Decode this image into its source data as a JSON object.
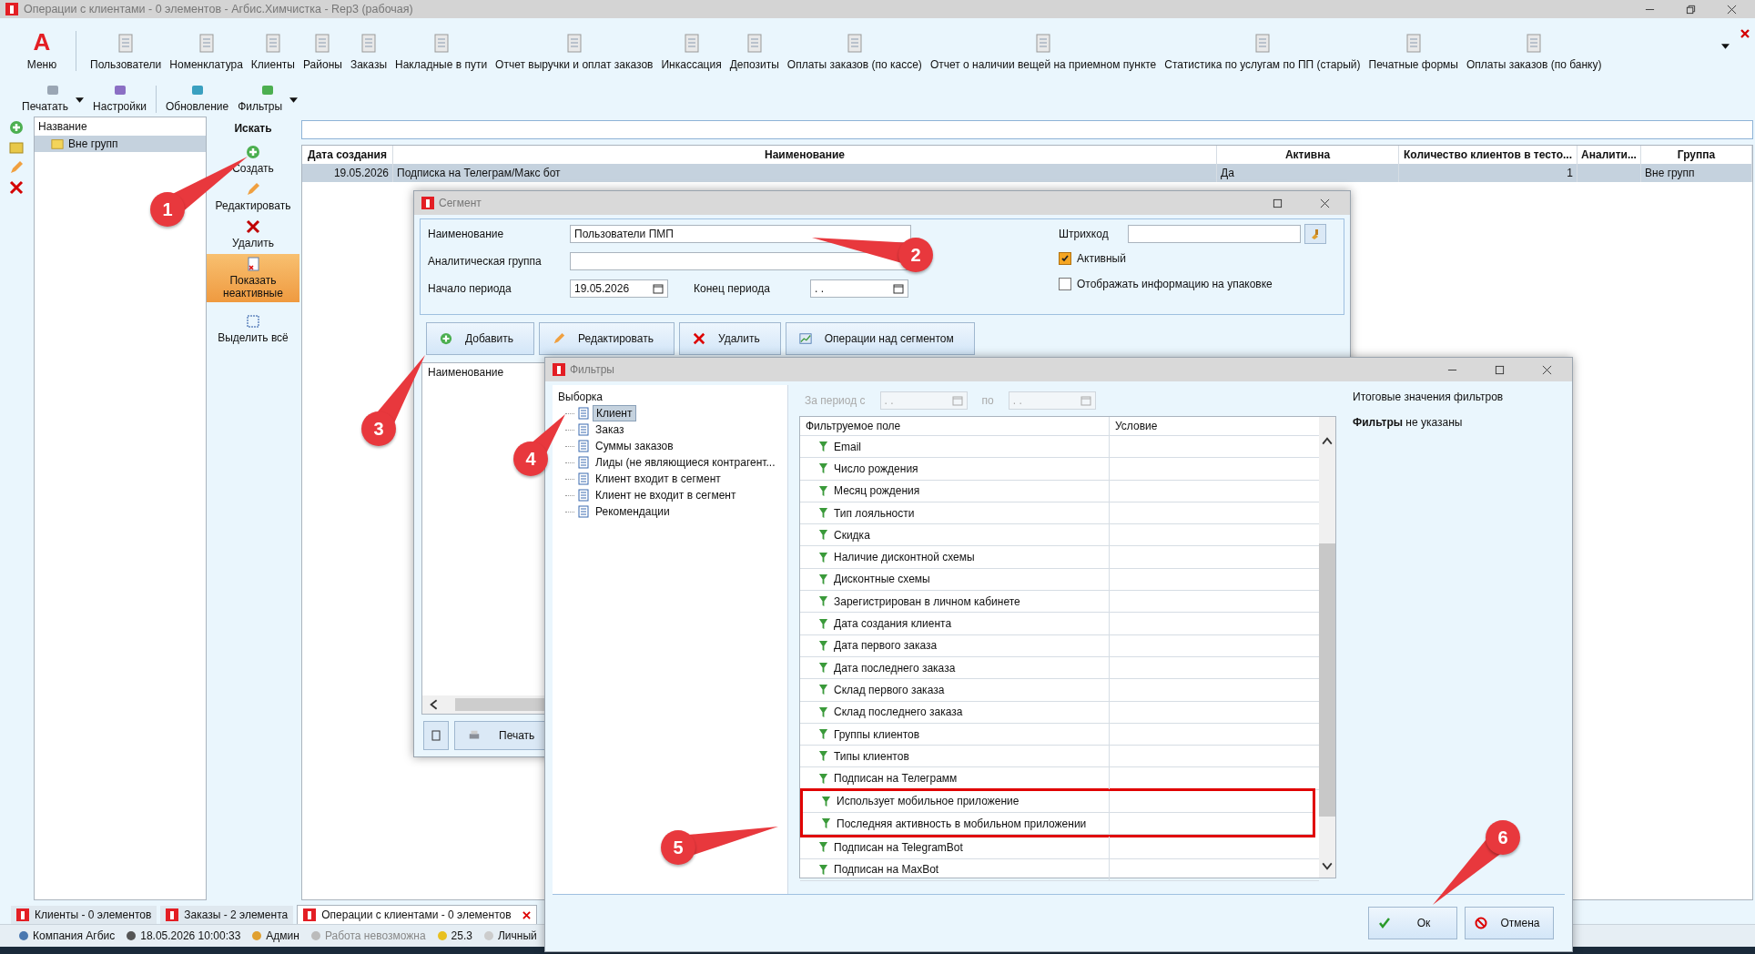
{
  "window": {
    "title": "Операции с клиентами - 0 элементов - Агбис.Химчистка - Rep3 (рабочая)"
  },
  "menu": {
    "logo": "A",
    "label": "Меню"
  },
  "toolbar": [
    "Пользователи",
    "Номенклатура",
    "Клиенты",
    "Районы",
    "Заказы",
    "Накладные в пути",
    "Отчет выручки и оплат заказов",
    "Инкассация",
    "Депозиты",
    "Оплаты заказов (по кассе)",
    "Отчет о наличии вещей на приемном пункте",
    "Статистика по услугам по ПП (старый)",
    "Печатные формы",
    "Оплаты заказов (по банку)"
  ],
  "toolbar2": [
    {
      "label": "Печатать",
      "dropdown": true
    },
    {
      "label": "Настройки",
      "dropdown": false
    },
    {
      "label": "Обновление",
      "dropdown": false
    },
    {
      "label": "Фильтры",
      "dropdown": true
    }
  ],
  "group_tree": {
    "header": "Название",
    "items": [
      {
        "label": "Вне групп",
        "selected": true
      }
    ]
  },
  "actions": {
    "search_label": "Искать",
    "items": [
      {
        "label": "Создать",
        "on": false
      },
      {
        "label": "Редактировать",
        "on": false
      },
      {
        "label": "Удалить",
        "on": false
      },
      {
        "label": "Показать неактивные",
        "on": true
      },
      {
        "label": "Выделить всё",
        "on": false
      }
    ]
  },
  "table": {
    "columns": [
      "Дата создания",
      "Наименование",
      "Активна",
      "Количество клиентов в тесто...",
      "Аналити...",
      "Группа"
    ],
    "rows": [
      {
        "selected": true,
        "date": "19.05.2026",
        "name": "Подписка на Телеграм/Макс бот",
        "active": "Да",
        "count": "1",
        "group": "Вне групп"
      }
    ]
  },
  "segment": {
    "title": "Сегмент",
    "name": {
      "label": "Наименование",
      "value": "Пользователи ПМП"
    },
    "analytic": {
      "label": "Аналитическая группа"
    },
    "period_start": {
      "label": "Начало периода",
      "value": "19.05.2026"
    },
    "period_end": {
      "label": "Конец периода",
      "value": ". ."
    },
    "barcode": {
      "label": "Штрихкод"
    },
    "checks": [
      {
        "label": "Активный",
        "checked": true
      },
      {
        "label": "Отображать информацию на упаковке",
        "checked": false
      }
    ],
    "buttons": [
      "Добавить",
      "Редактировать",
      "Удалить",
      "Операции над сегментом"
    ],
    "list_header": "Наименование",
    "print_button": "Печать"
  },
  "filters": {
    "title": "Фильтры",
    "tree": {
      "root": "Выборка",
      "children": [
        {
          "label": "Клиент",
          "selected": true
        },
        {
          "label": "Заказ",
          "selected": false
        },
        {
          "label": "Суммы заказов",
          "selected": false
        },
        {
          "label": "Лиды (не являющиеся контрагент...",
          "selected": false
        },
        {
          "label": "Клиент входит в сегмент",
          "selected": false
        },
        {
          "label": "Клиент не входит в сегмент",
          "selected": false
        },
        {
          "label": "Рекомендации",
          "selected": false
        }
      ]
    },
    "period": {
      "label_from": "За период с",
      "from": ". .",
      "label_to": "по",
      "to": ". .",
      "disabled": true
    },
    "grid": {
      "columns": [
        "Фильтруемое поле",
        "Условие"
      ],
      "rows": [
        "Email",
        "Число рождения",
        "Месяц рождения",
        "Тип лояльности",
        "Скидка",
        "Наличие дисконтной схемы",
        "Дисконтные схемы",
        "Зарегистрирован в личном кабинете",
        "Дата создания клиента",
        "Дата первого заказа",
        "Дата последнего заказа",
        "Склад первого заказа",
        "Склад последнего заказа",
        "Группы клиентов",
        "Типы клиентов",
        "Подписан на Телеграмм",
        "Использует мобильное приложение",
        "Последняя активность в мобильном приложении",
        "Подписан на TelegramBot",
        "Подписан на MaxBot"
      ]
    },
    "summary": {
      "title": "Итоговые значения фильтров",
      "text": "**Фильтры** не указаны"
    },
    "buttons": [
      {
        "label": "Ок",
        "kind": "ok"
      },
      {
        "label": "Отмена",
        "kind": "cancel"
      }
    ]
  },
  "tabs": [
    {
      "label": "Клиенты - 0 элементов",
      "selected": false
    },
    {
      "label": "Заказы - 2 элемента",
      "selected": false
    },
    {
      "label": "Операции с клиентами - 0 элементов",
      "selected": true
    }
  ],
  "status": [
    {
      "text": "Компания Агбис",
      "disabled": false
    },
    {
      "text": "18.05.2026 10:00:33",
      "disabled": false
    },
    {
      "text": "Админ",
      "disabled": false
    },
    {
      "text": "Работа невозможна",
      "disabled": true
    },
    {
      "text": "25.3",
      "disabled": false
    },
    {
      "text": "Личный",
      "disabled": false
    }
  ],
  "callouts": [
    "1",
    "2",
    "3",
    "4",
    "5",
    "6"
  ]
}
